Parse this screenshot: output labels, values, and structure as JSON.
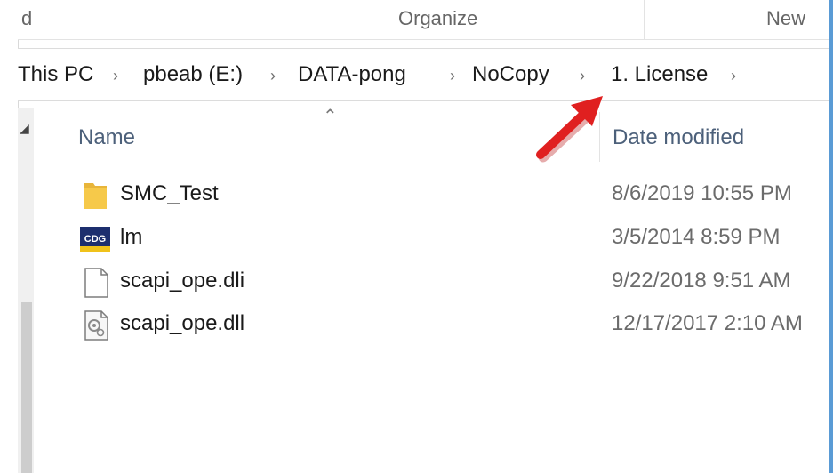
{
  "ribbon": {
    "partial_label": "d",
    "organize_label": "Organize",
    "new_label": "New"
  },
  "breadcrumb": {
    "items": [
      "This PC",
      "pbeab (E:)",
      "DATA-pong",
      "NoCopy",
      "1. License"
    ]
  },
  "columns": {
    "name": "Name",
    "date": "Date modified"
  },
  "files": [
    {
      "name": "SMC_Test",
      "date": "8/6/2019 10:55 PM",
      "icon": "folder-icon"
    },
    {
      "name": "lm",
      "date": "3/5/2014 8:59 PM",
      "icon": "cdg-app-icon",
      "icon_text": "CDG"
    },
    {
      "name": "scapi_ope.dli",
      "date": "9/22/2018 9:51 AM",
      "icon": "blank-file-icon"
    },
    {
      "name": "scapi_ope.dll",
      "date": "12/17/2017 2:10 AM",
      "icon": "dll-file-icon"
    }
  ],
  "colors": {
    "annotation_arrow": "#e02020",
    "folder": "#f6c94a",
    "header_text": "#4c607a"
  }
}
